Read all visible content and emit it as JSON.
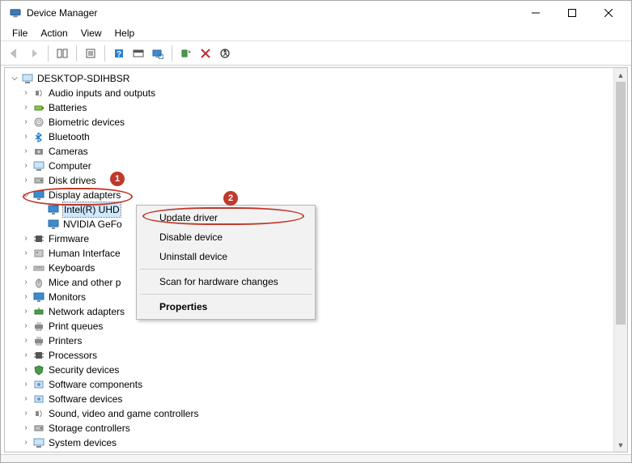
{
  "title": "Device Manager",
  "menus": {
    "file": "File",
    "action": "Action",
    "view": "View",
    "help": "Help"
  },
  "root": "DESKTOP-SDIHBSR",
  "categories": [
    "Audio inputs and outputs",
    "Batteries",
    "Biometric devices",
    "Bluetooth",
    "Cameras",
    "Computer",
    "Disk drives",
    "Display adapters",
    "Firmware",
    "Human Interface",
    "Keyboards",
    "Mice and other p",
    "Monitors",
    "Network adapters",
    "Print queues",
    "Printers",
    "Processors",
    "Security devices",
    "Software components",
    "Software devices",
    "Sound, video and game controllers",
    "Storage controllers",
    "System devices"
  ],
  "display_children": {
    "a": "Intel(R) UHD",
    "b": "NVIDIA GeFo"
  },
  "context_menu": {
    "update": "Update driver",
    "disable": "Disable device",
    "uninstall": "Uninstall device",
    "scan": "Scan for hardware changes",
    "props": "Properties"
  },
  "annotations": {
    "one": "1",
    "two": "2"
  }
}
